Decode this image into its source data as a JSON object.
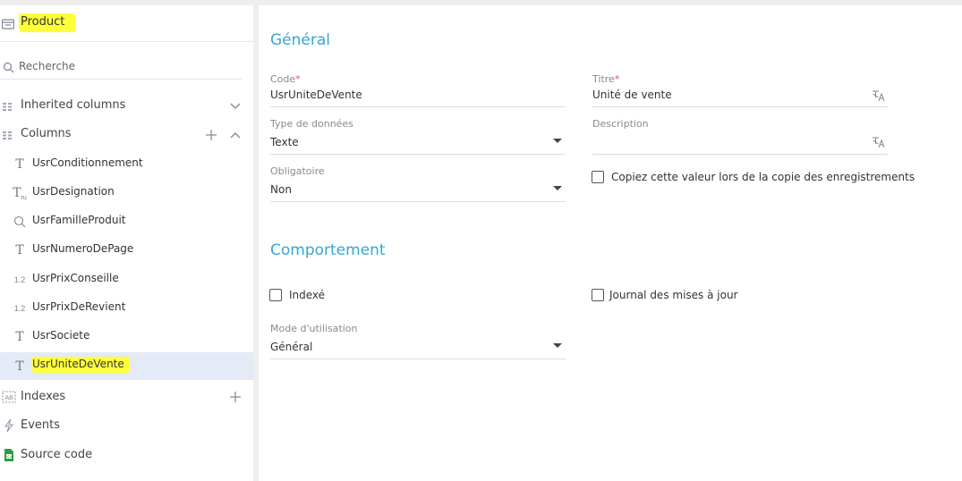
{
  "sidebar": {
    "object_title": "Product",
    "search_placeholder": "Recherche",
    "groups": {
      "inherited": "Inherited columns",
      "columns": "Columns"
    },
    "columns": [
      {
        "name": "UsrConditionnement",
        "icon": "text-type-icon",
        "glyph": "T"
      },
      {
        "name": "UsrDesignation",
        "icon": "multilang-text-type-icon",
        "glyph": "T"
      },
      {
        "name": "UsrFamilleProduit",
        "icon": "lookup-type-icon",
        "glyph": ""
      },
      {
        "name": "UsrNumeroDePage",
        "icon": "text-type-icon",
        "glyph": "T"
      },
      {
        "name": "UsrPrixConseille",
        "icon": "decimal-type-icon",
        "glyph": "1.2"
      },
      {
        "name": "UsrPrixDeRevient",
        "icon": "decimal-type-icon",
        "glyph": "1.2"
      },
      {
        "name": "UsrSociete",
        "icon": "text-type-icon",
        "glyph": "T"
      },
      {
        "name": "UsrUniteDeVente",
        "icon": "text-type-icon",
        "glyph": "T"
      }
    ],
    "nav": {
      "indexes": "Indexes",
      "events": "Events",
      "source_code": "Source code"
    }
  },
  "main": {
    "general_title": "Général",
    "code": {
      "label": "Code",
      "required_mark": "*",
      "value": "UsrUniteDeVente"
    },
    "titre": {
      "label": "Titre",
      "required_mark": "*",
      "value": "Unité de vente"
    },
    "type": {
      "label": "Type de données",
      "value": "Texte"
    },
    "description": {
      "label": "Description",
      "value": ""
    },
    "obligatoire": {
      "label": "Obligatoire",
      "value": "Non"
    },
    "copy_checkbox": "Copiez cette valeur lors de la copie des enregistrements",
    "behavior_title": "Comportement",
    "indexe_checkbox": "Indexé",
    "journal_checkbox": "Journal des mises à jour",
    "mode": {
      "label": "Mode d'utilisation",
      "value": "Général"
    }
  },
  "colors": {
    "accent": "#37a5d6",
    "highlight": "#ffff3a",
    "selected_row": "#e4eaf6",
    "required": "#e25454"
  }
}
